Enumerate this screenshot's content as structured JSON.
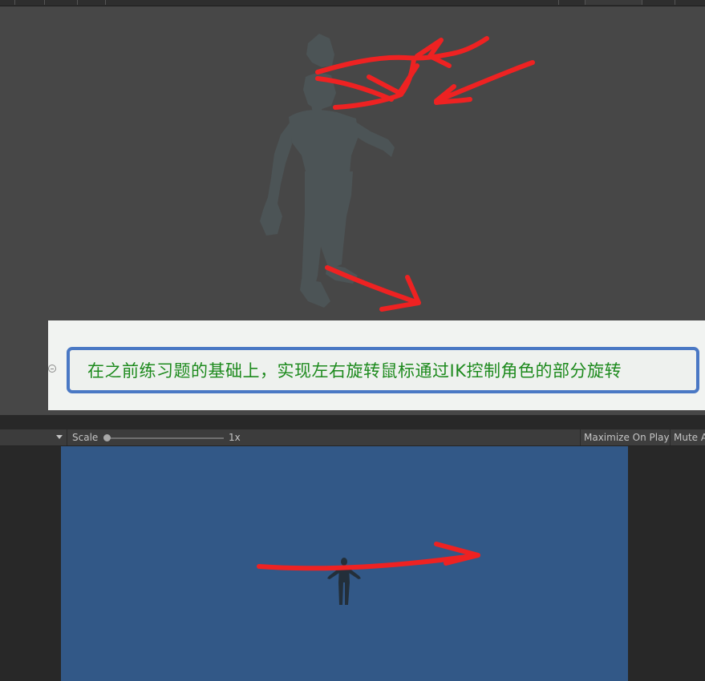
{
  "caption": {
    "text": "在之前练习题的基础上，实现左右旋转鼠标通过IK控制角色的部分旋转"
  },
  "game_toolbar": {
    "scale_label": "Scale",
    "scale_value": "1x",
    "maximize_on_play": "Maximize On Play",
    "mute_audio": "Mute A"
  },
  "icons": [
    "dropdown-arrow-icon",
    "collapse-icon"
  ],
  "colors": {
    "scene_background": "#474747",
    "game_background": "#325887",
    "annotation_red": "#ee2222",
    "caption_text": "#1d8a1d",
    "caption_border": "#4a78c4"
  }
}
